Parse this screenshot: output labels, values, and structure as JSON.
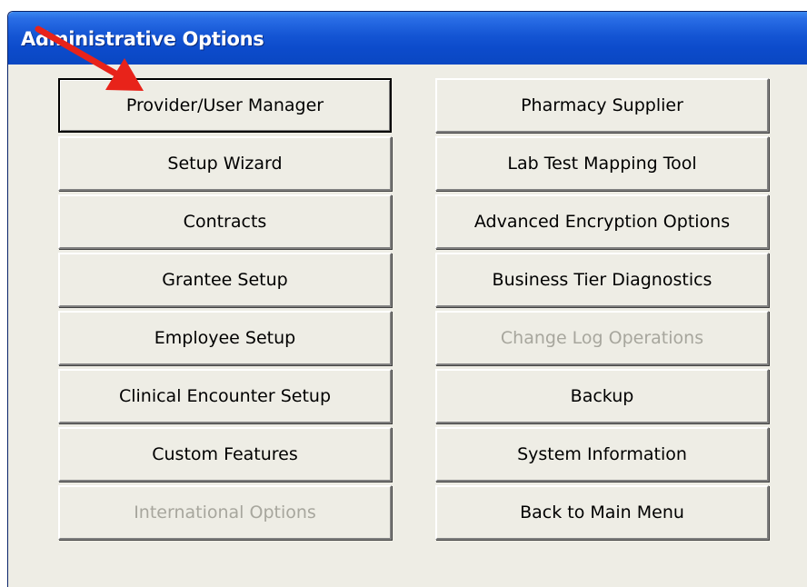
{
  "window": {
    "title": "Administrative Options"
  },
  "left_buttons": [
    {
      "label": "Provider/User Manager",
      "focused": true,
      "disabled": false
    },
    {
      "label": "Setup Wizard",
      "focused": false,
      "disabled": false
    },
    {
      "label": "Contracts",
      "focused": false,
      "disabled": false
    },
    {
      "label": "Grantee Setup",
      "focused": false,
      "disabled": false
    },
    {
      "label": "Employee Setup",
      "focused": false,
      "disabled": false
    },
    {
      "label": "Clinical Encounter Setup",
      "focused": false,
      "disabled": false
    },
    {
      "label": "Custom Features",
      "focused": false,
      "disabled": false
    },
    {
      "label": "International Options",
      "focused": false,
      "disabled": true
    }
  ],
  "right_buttons": [
    {
      "label": "Pharmacy Supplier",
      "focused": false,
      "disabled": false
    },
    {
      "label": "Lab Test Mapping Tool",
      "focused": false,
      "disabled": false
    },
    {
      "label": "Advanced Encryption Options",
      "focused": false,
      "disabled": false
    },
    {
      "label": "Business Tier Diagnostics",
      "focused": false,
      "disabled": false
    },
    {
      "label": "Change Log Operations",
      "focused": false,
      "disabled": true
    },
    {
      "label": "Backup",
      "focused": false,
      "disabled": false
    },
    {
      "label": "System Information",
      "focused": false,
      "disabled": false
    },
    {
      "label": "Back to Main Menu",
      "focused": false,
      "disabled": false
    }
  ],
  "colors": {
    "title_bar": "#0c4bcb",
    "dialog_background": "#eeede5",
    "disabled_text": "#a7a69d",
    "annotation_arrow": "#e8231a"
  },
  "annotation": {
    "icon": "red-arrow-icon",
    "points_to": "Provider/User Manager"
  }
}
